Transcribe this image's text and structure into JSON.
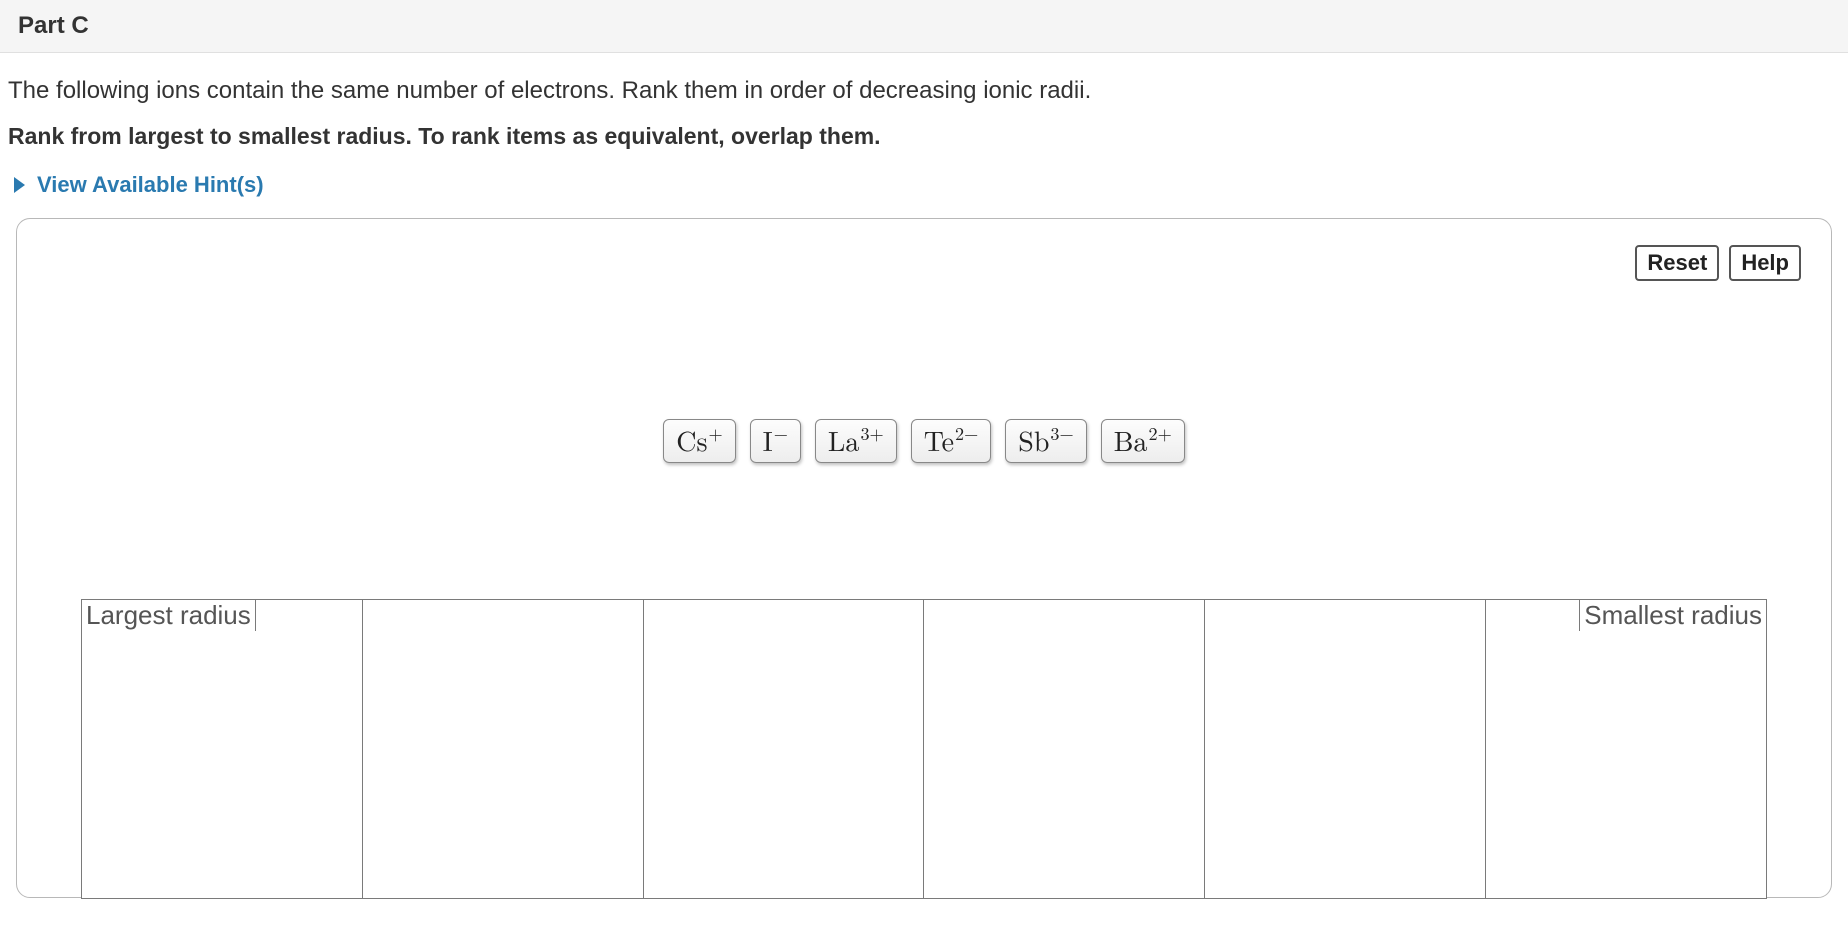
{
  "header": {
    "title": "Part C"
  },
  "instructions": {
    "line1": "The following ions contain the same number of electrons. Rank them in order of decreasing ionic radii.",
    "line2_bold": "Rank from largest to smallest radius. To rank items as equivalent, overlap them."
  },
  "hints": {
    "toggle_label": "View Available Hint(s)"
  },
  "buttons": {
    "reset": "Reset",
    "help": "Help"
  },
  "items": [
    {
      "base": "Cs",
      "charge": "+"
    },
    {
      "base": "I",
      "charge": "−"
    },
    {
      "base": "La",
      "charge": "3+"
    },
    {
      "base": "Te",
      "charge": "2−"
    },
    {
      "base": "Sb",
      "charge": "3−"
    },
    {
      "base": "Ba",
      "charge": "2+"
    }
  ],
  "axis": {
    "left_label": "Largest radius",
    "right_label": "Smallest radius",
    "slot_count": 6
  }
}
